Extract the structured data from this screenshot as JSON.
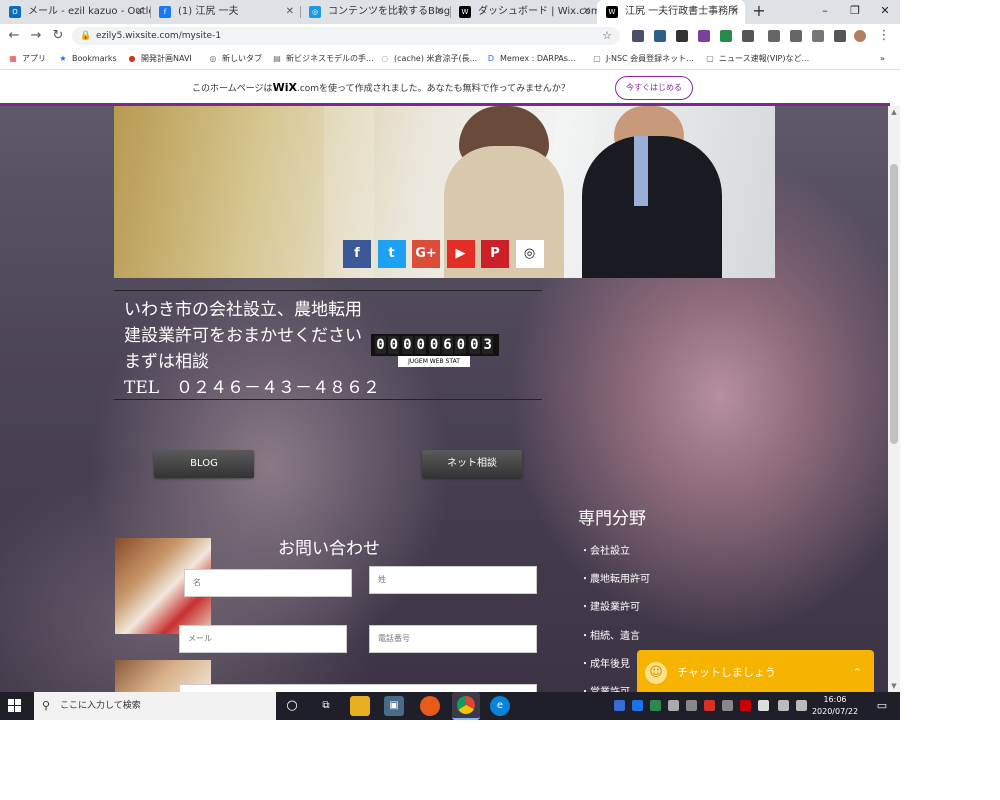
{
  "browser": {
    "tabs": [
      {
        "label": "メール - ezil kazuo - Outlook",
        "icon": "outlook-icon",
        "color": "#0f6cbd",
        "glyph": "O"
      },
      {
        "label": "(1) 江尻 一夫",
        "icon": "facebook-icon",
        "color": "#1877f2",
        "glyph": "f"
      },
      {
        "label": "コンテンツを比較するBlog方法",
        "icon": "site-icon",
        "color": "#1a9ae0",
        "glyph": "◎"
      },
      {
        "label": "ダッシュボード | Wix.com",
        "icon": "wix-icon",
        "color": "#000000",
        "glyph": "W"
      },
      {
        "label": "江尻 一夫行政書士事務所",
        "icon": "wix-icon",
        "color": "#000000",
        "glyph": "W"
      }
    ],
    "new_tab": "+",
    "window_controls": [
      "–",
      "❐",
      "✕"
    ],
    "url": "ezily5.wixsite.com/mysite-1",
    "bookmarks": [
      {
        "label": "アプリ",
        "icon": "apps-icon",
        "color": "#d44",
        "glyph": "▦"
      },
      {
        "label": "Bookmarks",
        "icon": "star-icon",
        "color": "#1a73e8",
        "glyph": "★"
      },
      {
        "label": "開発計画NAVI",
        "icon": "bookmark-site-icon",
        "color": "#d93025",
        "glyph": "●"
      },
      {
        "label": "新しいタブ",
        "icon": "globe-icon",
        "color": "#5f6368",
        "glyph": "◎"
      },
      {
        "label": "新ビジネスモデルの手...",
        "icon": "page-icon",
        "color": "#5f6368",
        "glyph": "▤"
      },
      {
        "label": "(cache) 米倉涼子(長...",
        "icon": "page-icon",
        "color": "#5f6368",
        "glyph": "◌"
      },
      {
        "label": "Memex : DARPAs...",
        "icon": "page-icon",
        "color": "#1a73e8",
        "glyph": "D"
      },
      {
        "label": "J-NSC 会員登録ネット...",
        "icon": "page-icon",
        "color": "#5f6368",
        "glyph": "▢"
      },
      {
        "label": "ニュース速報(VIP)など...",
        "icon": "page-icon",
        "color": "#5f6368",
        "glyph": "▢"
      }
    ],
    "bookmarks_more": "»"
  },
  "wix_banner": {
    "before": "このホームページは",
    "brand": "WiX",
    "brand_suffix": ".com",
    "after": "を使って作成されました。あなたも無料で作ってみませんか？",
    "cta": "今すぐはじめる"
  },
  "page": {
    "social": [
      {
        "name": "facebook-icon",
        "glyph": "f",
        "color": "#3b5998"
      },
      {
        "name": "twitter-icon",
        "glyph": "t",
        "color": "#1da1f2"
      },
      {
        "name": "googleplus-icon",
        "glyph": "G+",
        "color": "#dd4b39"
      },
      {
        "name": "youtube-icon",
        "glyph": "▶",
        "color": "#e52d27"
      },
      {
        "name": "pinterest-icon",
        "glyph": "P",
        "color": "#cb2027"
      },
      {
        "name": "instagram-icon",
        "glyph": "◎",
        "color": "#ffffff"
      }
    ],
    "info_lines": [
      "いわき市の会社設立、農地転用",
      "建設業許可をおまかせください",
      "まずは相談",
      "TEL　０２４６－４３－４８６２"
    ],
    "counter_digits": "000006003",
    "counter_label": "JUGEM WEB STAT",
    "blog_button": "BLOG",
    "net_button": "ネット相談",
    "contact_title": "お問い合わせ",
    "fields": [
      "名",
      "姓",
      "メール",
      "電話番号"
    ],
    "specialty_title": "専門分野",
    "specialties": [
      "・会社設立",
      "・農地転用許可",
      "・建設業許可",
      "・相続、遺言",
      "・成年後見",
      "・営業許可"
    ],
    "chat_label": "チャットしましょう",
    "chat_chevron": "⌃"
  },
  "taskbar": {
    "search_placeholder": "ここに入力して検索",
    "clock_time": "16:06",
    "clock_date": "2020/07/22"
  },
  "colors": {
    "wix_purple": "#7a2a8a",
    "chat_yellow": "#f6b300",
    "taskbar": "#1f1f2a"
  }
}
